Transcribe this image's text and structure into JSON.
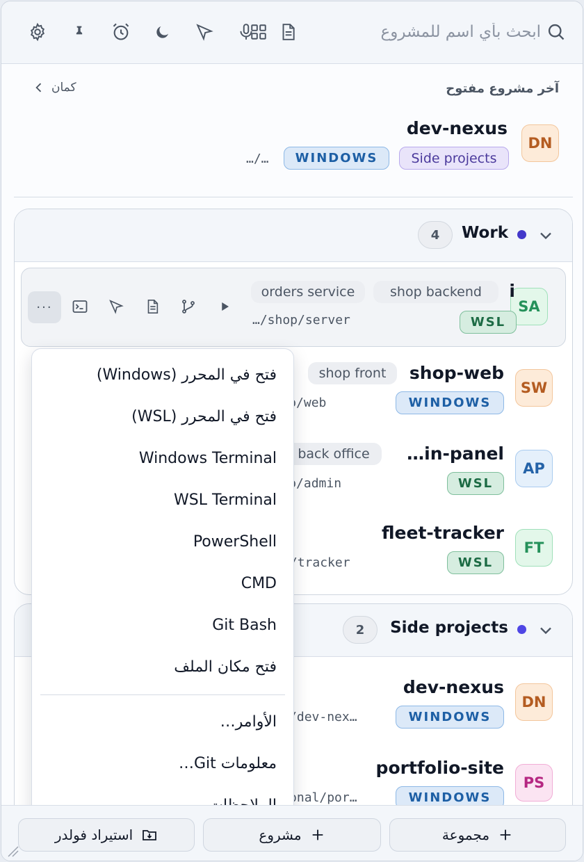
{
  "topbar": {
    "search_placeholder": "ابحث بأي اسم للمشروع",
    "icons": [
      "search-icon",
      "grid-icon",
      "document-icon",
      "microphone-icon",
      "send-icon",
      "moon-icon",
      "alarm-icon",
      "pin-icon",
      "gear-icon"
    ]
  },
  "recent": {
    "title": "آخر مشروع مفتوح",
    "more_label": "كمان",
    "project": {
      "initials": "DN",
      "name": "dev-nexus",
      "group_badge": "Side projects",
      "os_badge": "WINDOWS",
      "path": "…/…"
    }
  },
  "groups": [
    {
      "name": "Work",
      "count": "4",
      "dot_color": "#4338ca",
      "projects": [
        {
          "initials": "SA",
          "name": "i",
          "tags": [
            "shop backend",
            "orders service"
          ],
          "os": "WSL",
          "path": "…/shop/server"
        },
        {
          "initials": "SW",
          "name": "shop-web",
          "tags": [
            "shop front"
          ],
          "os": "WINDOWS",
          "path": "…/shop/web"
        },
        {
          "initials": "AP",
          "name": "…in-panel",
          "tags": [
            "back office"
          ],
          "os": "WSL",
          "path": "…/shop/admin"
        },
        {
          "initials": "FT",
          "name": "fleet-tracker",
          "tags": [],
          "os": "WSL",
          "path": "…/fleet/tracker"
        }
      ]
    },
    {
      "name": "Side projects",
      "count": "2",
      "dot_color": "#4f46e5",
      "projects": [
        {
          "initials": "DN",
          "name": "dev-nexus",
          "tags": [],
          "os": "WINDOWS",
          "path": "…/work/dev-nex…"
        },
        {
          "initials": "PS",
          "name": "portfolio-site",
          "tags": [],
          "os": "WINDOWS",
          "path": "…/personal/por…"
        }
      ]
    }
  ],
  "context_menu": {
    "items": [
      "فتح في المحرر (Windows)",
      "فتح في المحرر (WSL)",
      "Windows Terminal",
      "WSL Terminal",
      "PowerShell",
      "CMD",
      "Git Bash",
      "فتح مكان الملف"
    ],
    "items_after_separator": [
      "الأوامر…",
      "معلومات Git…",
      "الملاحظات"
    ]
  },
  "bottombar": {
    "import_label": "استيراد فولدر",
    "project_label": "مشروع",
    "group_label": "مجموعة"
  }
}
